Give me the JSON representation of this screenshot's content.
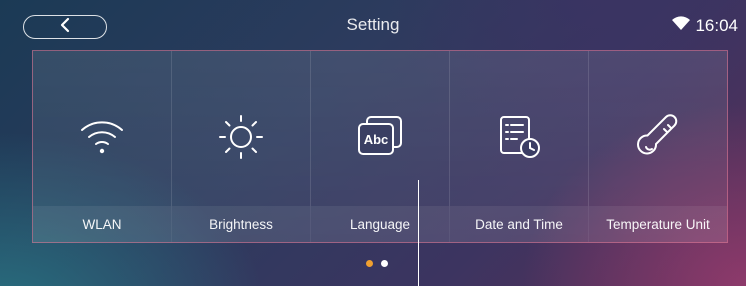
{
  "header": {
    "title": "Setting",
    "time": "16:04",
    "back_icon": "chevron-left-icon",
    "wifi_icon": "wifi-icon"
  },
  "tiles": [
    {
      "label": "WLAN",
      "icon": "wifi-icon"
    },
    {
      "label": "Brightness",
      "icon": "sun-icon"
    },
    {
      "label": "Language",
      "icon": "language-abc-icon"
    },
    {
      "label": "Date and Time",
      "icon": "calendar-clock-icon"
    },
    {
      "label": "Temperature Unit",
      "icon": "thermometer-icon"
    }
  ],
  "pagination": {
    "pages": 2,
    "current": 1,
    "active_color": "#f0a030",
    "inactive_color": "#ffffff"
  }
}
